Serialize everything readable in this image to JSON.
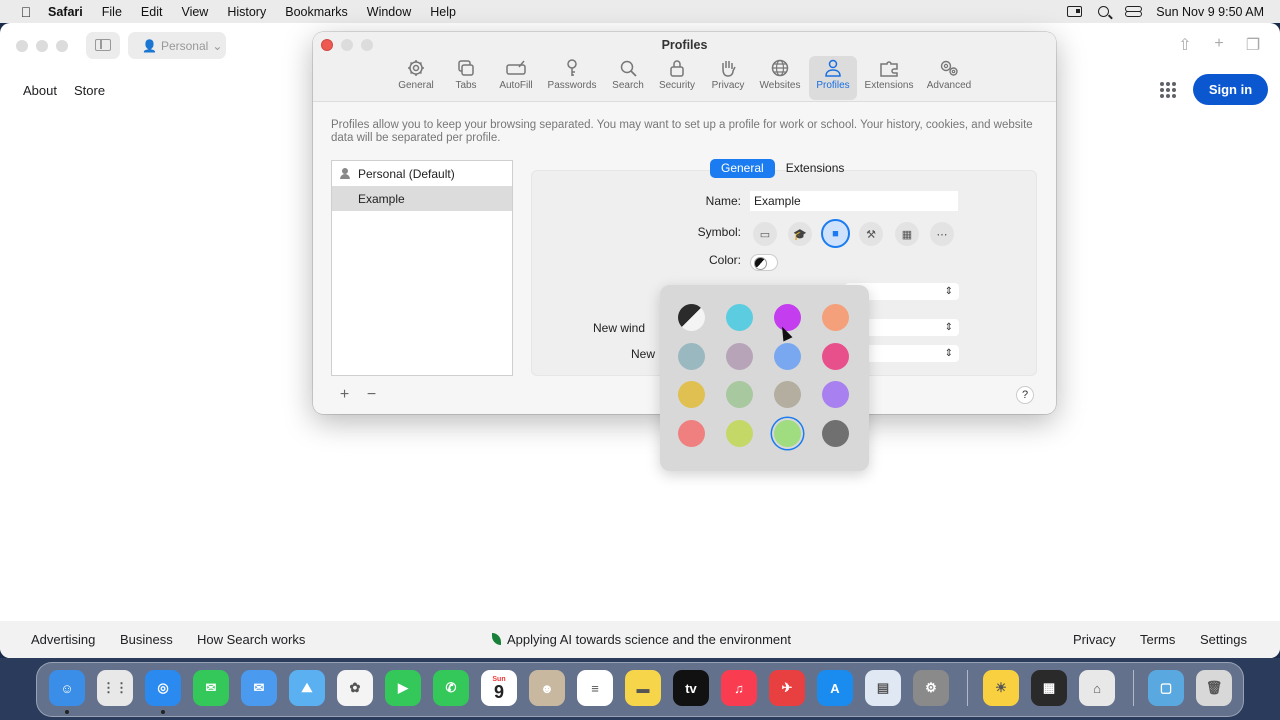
{
  "menubar": {
    "app_name": "Safari",
    "menus": [
      "File",
      "Edit",
      "View",
      "History",
      "Bookmarks",
      "Window",
      "Help"
    ],
    "datetime": "Sun Nov 9  9:50 AM"
  },
  "browser": {
    "profile_button": "Personal",
    "google": {
      "top_links": [
        "About",
        "Store"
      ],
      "sign_in": "Sign in",
      "footer_left": [
        "Advertising",
        "Business",
        "How Search works"
      ],
      "footer_center": "Applying AI towards science and the environment",
      "footer_right": [
        "Privacy",
        "Terms",
        "Settings"
      ]
    }
  },
  "prefs": {
    "title": "Profiles",
    "tabs": [
      {
        "label": "General",
        "icon": "gear-icon"
      },
      {
        "label": "Tabs",
        "icon": "tabs-icon"
      },
      {
        "label": "AutoFill",
        "icon": "autofill-icon"
      },
      {
        "label": "Passwords",
        "icon": "key-icon"
      },
      {
        "label": "Search",
        "icon": "search-icon"
      },
      {
        "label": "Security",
        "icon": "lock-icon"
      },
      {
        "label": "Privacy",
        "icon": "hand-icon"
      },
      {
        "label": "Websites",
        "icon": "globe-icon"
      },
      {
        "label": "Profiles",
        "icon": "person-icon",
        "active": true
      },
      {
        "label": "Extensions",
        "icon": "extensions-icon"
      },
      {
        "label": "Advanced",
        "icon": "gears-icon"
      }
    ],
    "description": "Profiles allow you to keep your browsing separated. You may want to set up a profile for work or school. Your history, cookies, and website data will be separated per profile.",
    "profiles": [
      "Personal (Default)",
      "Example"
    ],
    "selected_profile": "Example",
    "segments": [
      "General",
      "Extensions"
    ],
    "active_segment": "General",
    "name_label": "Name:",
    "name_value": "Example",
    "symbol_label": "Symbol:",
    "symbols": [
      "id-badge-icon",
      "graduation-cap-icon",
      "briefcase-icon",
      "hammer-icon",
      "building-icon",
      "more-icon"
    ],
    "selected_symbol": "briefcase-icon",
    "color_label": "Color:",
    "partial_labels": [
      "New wind",
      "New"
    ],
    "add_label": "+",
    "remove_label": "−",
    "help_label": "?"
  },
  "color_picker": {
    "swatches": [
      "#2b2b2b",
      "#5ccde0",
      "#c43ef0",
      "#f4a07a",
      "#9ab8c0",
      "#b8a4b8",
      "#7aa8f0",
      "#e8508c",
      "#e0c050",
      "#a8c8a0",
      "#b4aea0",
      "#a880f0",
      "#f08080",
      "#c4d868",
      "#a0dc80",
      "#707070"
    ],
    "selected_index": 14
  },
  "dock": {
    "apps": [
      "Finder",
      "Launchpad",
      "Safari",
      "Messages",
      "Mail",
      "Maps",
      "Photos",
      "FaceTime",
      "Phone",
      "Calendar",
      "Contacts",
      "Reminders",
      "Notes",
      "TV",
      "Music",
      "Rocket",
      "App Store",
      "Preview",
      "System Settings",
      "Tips",
      "Archiver",
      "Installer",
      "Downloads",
      "Trash"
    ],
    "calendar_day": "9",
    "calendar_month": "Sun"
  }
}
